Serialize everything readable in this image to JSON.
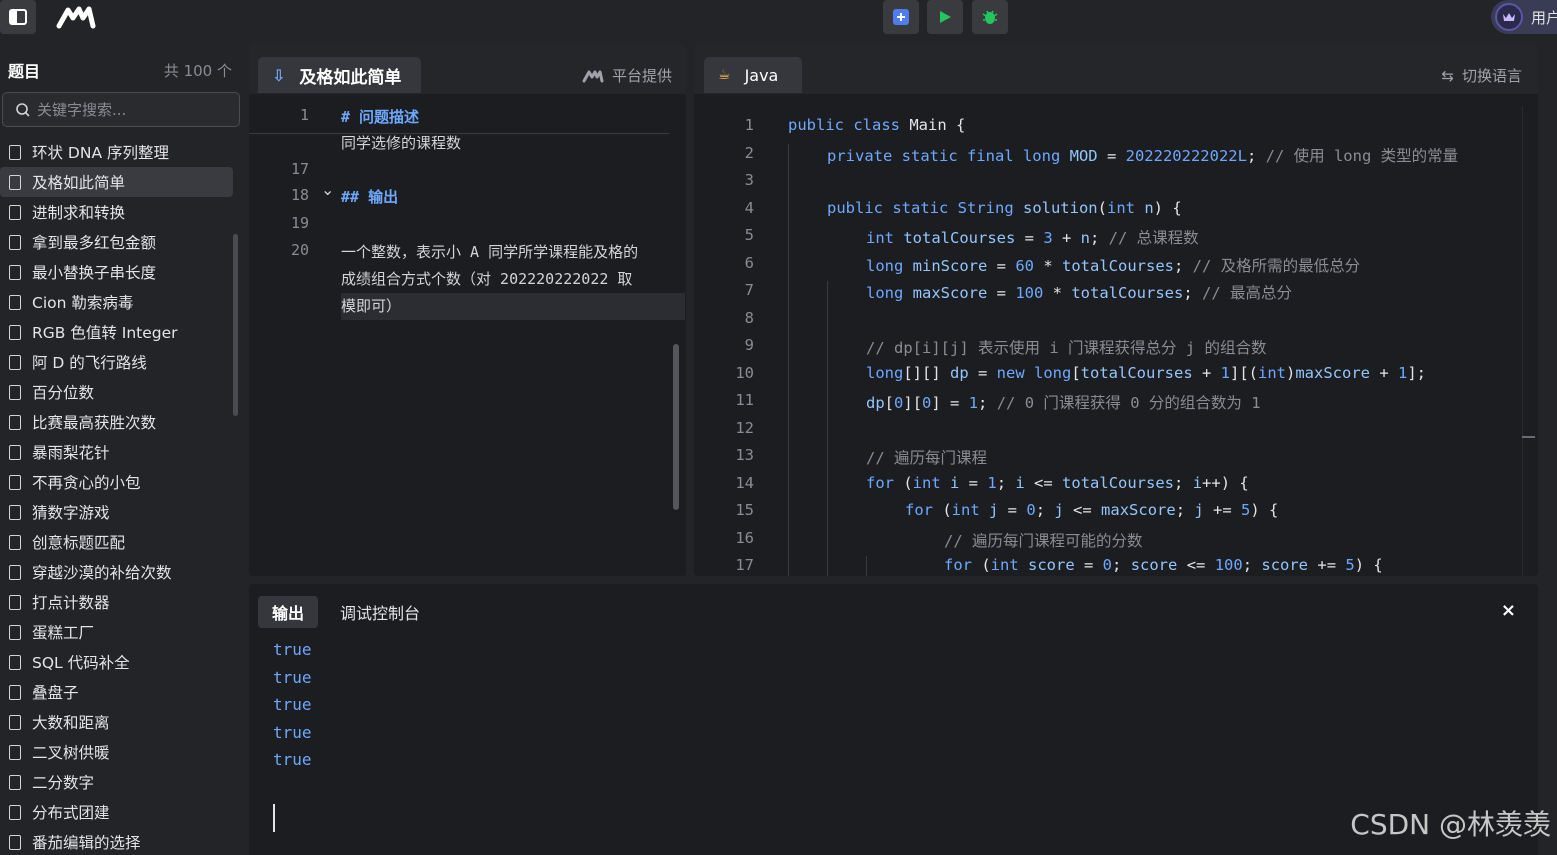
{
  "topbar": {
    "user_label": "用户",
    "icons": [
      "sidebar-toggle-icon",
      "logo",
      "add-icon",
      "run-icon",
      "debug-icon",
      "crown-icon"
    ]
  },
  "sidebar": {
    "title": "题目",
    "count": "共 100 个",
    "search_placeholder": "关键字搜索...",
    "active_index": 1,
    "items": [
      {
        "label": "环状 DNA 序列整理"
      },
      {
        "label": "及格如此简单"
      },
      {
        "label": "进制求和转换"
      },
      {
        "label": "拿到最多红包金额"
      },
      {
        "label": "最小替换子串长度"
      },
      {
        "label": "Cion 勒索病毒"
      },
      {
        "label": "RGB 色值转 Integer"
      },
      {
        "label": "阿 D 的飞行路线"
      },
      {
        "label": "百分位数"
      },
      {
        "label": "比赛最高获胜次数"
      },
      {
        "label": "暴雨梨花针"
      },
      {
        "label": "不再贪心的小包"
      },
      {
        "label": "猜数字游戏"
      },
      {
        "label": "创意标题匹配"
      },
      {
        "label": "穿越沙漠的补给次数"
      },
      {
        "label": "打点计数器"
      },
      {
        "label": "蛋糕工厂"
      },
      {
        "label": "SQL 代码补全"
      },
      {
        "label": "叠盘子"
      },
      {
        "label": "大数和距离"
      },
      {
        "label": "二叉树供暖"
      },
      {
        "label": "二分数字"
      },
      {
        "label": "分布式团建"
      },
      {
        "label": "番茄编辑的选择"
      }
    ]
  },
  "description": {
    "tab_label": "及格如此简单",
    "source_label": "平台提供",
    "lines": [
      {
        "num": "1",
        "text": "# 问题描述",
        "heading": true
      },
      {
        "num": "",
        "text": "同学选修的课程数",
        "heading": false
      },
      {
        "num": "17",
        "text": "",
        "heading": false
      },
      {
        "num": "18",
        "text": "## 输出",
        "heading": true
      },
      {
        "num": "19",
        "text": "",
        "heading": false
      },
      {
        "num": "20",
        "text": "一个整数，表示小 A 同学所学课程能及格的",
        "heading": false
      },
      {
        "num": "",
        "text": "成绩组合方式个数（对 202220222022 取",
        "heading": false
      },
      {
        "num": "",
        "text": "模即可）",
        "heading": false
      }
    ]
  },
  "editor": {
    "language_label": "Java",
    "switch_label": "切换语言",
    "lines": [
      {
        "num": "1",
        "indent": 0,
        "tokens": [
          [
            "kw",
            "public class "
          ],
          [
            "nm",
            "Main {"
          ]
        ]
      },
      {
        "num": "2",
        "indent": 1,
        "tokens": [
          [
            "kw",
            "private static final long "
          ],
          [
            "id",
            "MOD"
          ],
          [
            "nm",
            " = "
          ],
          [
            "num",
            "202220222022L"
          ],
          [
            "nm",
            "; "
          ],
          [
            "cm",
            "// 使用 long 类型的常量"
          ]
        ]
      },
      {
        "num": "3",
        "indent": 0,
        "tokens": []
      },
      {
        "num": "4",
        "indent": 1,
        "tokens": [
          [
            "kw",
            "public static "
          ],
          [
            "ty",
            "String "
          ],
          [
            "id",
            "solution"
          ],
          [
            "nm",
            "("
          ],
          [
            "kw",
            "int "
          ],
          [
            "id",
            "n"
          ],
          [
            "nm",
            ") {"
          ]
        ]
      },
      {
        "num": "5",
        "indent": 2,
        "tokens": [
          [
            "kw",
            "int "
          ],
          [
            "id",
            "totalCourses"
          ],
          [
            "nm",
            " = "
          ],
          [
            "num",
            "3"
          ],
          [
            "nm",
            " + "
          ],
          [
            "id",
            "n"
          ],
          [
            "nm",
            "; "
          ],
          [
            "cm",
            "// 总课程数"
          ]
        ]
      },
      {
        "num": "6",
        "indent": 2,
        "tokens": [
          [
            "kw",
            "long "
          ],
          [
            "id",
            "minScore"
          ],
          [
            "nm",
            " = "
          ],
          [
            "num",
            "60"
          ],
          [
            "nm",
            " * "
          ],
          [
            "id",
            "totalCourses"
          ],
          [
            "nm",
            "; "
          ],
          [
            "cm",
            "// 及格所需的最低总分"
          ]
        ]
      },
      {
        "num": "7",
        "indent": 2,
        "tokens": [
          [
            "kw",
            "long "
          ],
          [
            "id",
            "maxScore"
          ],
          [
            "nm",
            " = "
          ],
          [
            "num",
            "100"
          ],
          [
            "nm",
            " * "
          ],
          [
            "id",
            "totalCourses"
          ],
          [
            "nm",
            "; "
          ],
          [
            "cm",
            "// 最高总分"
          ]
        ]
      },
      {
        "num": "8",
        "indent": 0,
        "tokens": []
      },
      {
        "num": "9",
        "indent": 2,
        "tokens": [
          [
            "cm",
            "// dp[i][j] 表示使用 i 门课程获得总分 j 的组合数"
          ]
        ]
      },
      {
        "num": "10",
        "indent": 2,
        "tokens": [
          [
            "kw",
            "long"
          ],
          [
            "nm",
            "[][] "
          ],
          [
            "id",
            "dp"
          ],
          [
            "nm",
            " = "
          ],
          [
            "kw",
            "new long"
          ],
          [
            "nm",
            "["
          ],
          [
            "id",
            "totalCourses"
          ],
          [
            "nm",
            " + "
          ],
          [
            "num",
            "1"
          ],
          [
            "nm",
            "][("
          ],
          [
            "kw",
            "int"
          ],
          [
            "nm",
            ")"
          ],
          [
            "id",
            "maxScore"
          ],
          [
            "nm",
            " + "
          ],
          [
            "num",
            "1"
          ],
          [
            "nm",
            "];"
          ]
        ]
      },
      {
        "num": "11",
        "indent": 2,
        "tokens": [
          [
            "id",
            "dp"
          ],
          [
            "nm",
            "["
          ],
          [
            "num",
            "0"
          ],
          [
            "nm",
            "]["
          ],
          [
            "num",
            "0"
          ],
          [
            "nm",
            "] = "
          ],
          [
            "num",
            "1"
          ],
          [
            "nm",
            "; "
          ],
          [
            "cm",
            "// 0 门课程获得 0 分的组合数为 1"
          ]
        ]
      },
      {
        "num": "12",
        "indent": 0,
        "tokens": []
      },
      {
        "num": "13",
        "indent": 2,
        "tokens": [
          [
            "cm",
            "// 遍历每门课程"
          ]
        ]
      },
      {
        "num": "14",
        "indent": 2,
        "tokens": [
          [
            "kw",
            "for "
          ],
          [
            "nm",
            "("
          ],
          [
            "kw",
            "int "
          ],
          [
            "id",
            "i"
          ],
          [
            "nm",
            " = "
          ],
          [
            "num",
            "1"
          ],
          [
            "nm",
            "; "
          ],
          [
            "id",
            "i"
          ],
          [
            "nm",
            " <= "
          ],
          [
            "id",
            "totalCourses"
          ],
          [
            "nm",
            "; "
          ],
          [
            "id",
            "i"
          ],
          [
            "nm",
            "++) {"
          ]
        ]
      },
      {
        "num": "15",
        "indent": 3,
        "tokens": [
          [
            "kw",
            "for "
          ],
          [
            "nm",
            "("
          ],
          [
            "kw",
            "int "
          ],
          [
            "id",
            "j"
          ],
          [
            "nm",
            " = "
          ],
          [
            "num",
            "0"
          ],
          [
            "nm",
            "; "
          ],
          [
            "id",
            "j"
          ],
          [
            "nm",
            " <= "
          ],
          [
            "id",
            "maxScore"
          ],
          [
            "nm",
            "; "
          ],
          [
            "id",
            "j"
          ],
          [
            "nm",
            " += "
          ],
          [
            "num",
            "5"
          ],
          [
            "nm",
            ") {"
          ]
        ]
      },
      {
        "num": "16",
        "indent": 4,
        "tokens": [
          [
            "cm",
            "// 遍历每门课程可能的分数"
          ]
        ]
      },
      {
        "num": "17",
        "indent": 4,
        "tokens": [
          [
            "kw",
            "for "
          ],
          [
            "nm",
            "("
          ],
          [
            "kw",
            "int "
          ],
          [
            "id",
            "score"
          ],
          [
            "nm",
            " = "
          ],
          [
            "num",
            "0"
          ],
          [
            "nm",
            "; "
          ],
          [
            "id",
            "score"
          ],
          [
            "nm",
            " <= "
          ],
          [
            "num",
            "100"
          ],
          [
            "nm",
            "; "
          ],
          [
            "id",
            "score"
          ],
          [
            "nm",
            " += "
          ],
          [
            "num",
            "5"
          ],
          [
            "nm",
            ") {"
          ]
        ]
      }
    ]
  },
  "output": {
    "tabs": [
      "输出",
      "调试控制台"
    ],
    "close_label": "×",
    "lines": [
      "true",
      "true",
      "true",
      "true",
      "true"
    ]
  },
  "watermark": "CSDN @林羡羡"
}
